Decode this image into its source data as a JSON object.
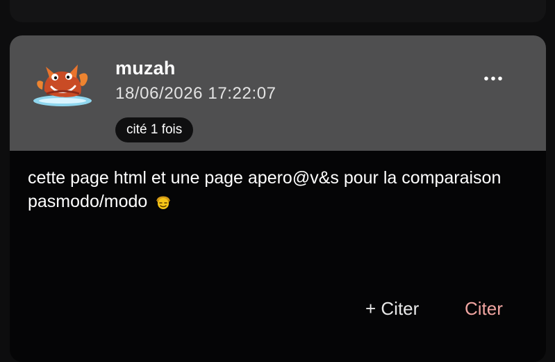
{
  "post": {
    "username": "muzah",
    "timestamp": "18/06/2026 17:22:07",
    "quote_count_badge": "cité 1 fois",
    "message_text": "cette page html et une page apero@v&s pour la comparaison pasmodo/modo",
    "message_emoji": "smiling-face-with-cap-emoji",
    "avatar_icon": "crab-avatar-icon",
    "more_icon": "more-options-icon"
  },
  "actions": {
    "add_quote_label": "+ Citer",
    "quote_label": "Citer"
  },
  "colors": {
    "page_background": "#0d0d0e",
    "header_background": "#4f4f50",
    "body_background": "#050506",
    "quote_accent": "#f0a5a1"
  }
}
